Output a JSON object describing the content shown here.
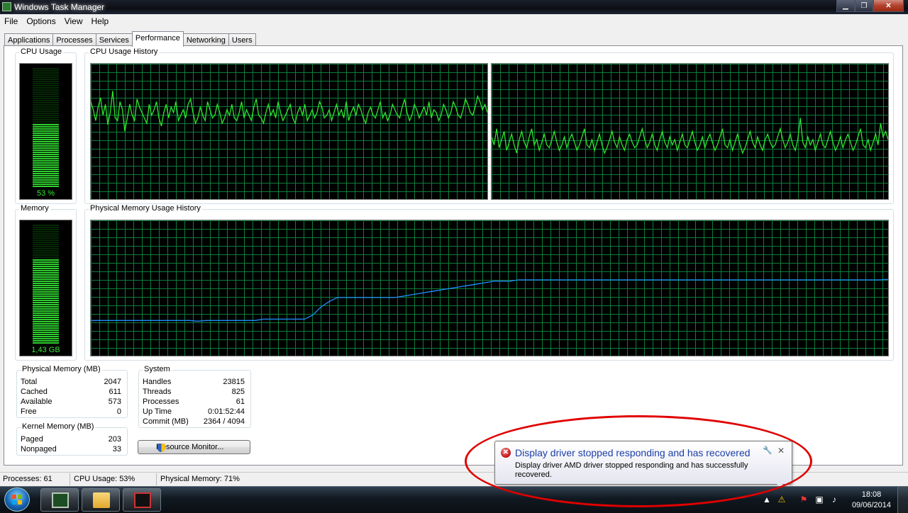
{
  "window": {
    "title": "Windows Task Manager",
    "controls": {
      "minimize": "▁",
      "maximize": "❐",
      "close": "✕"
    }
  },
  "menu": [
    "File",
    "Options",
    "View",
    "Help"
  ],
  "tabs": [
    {
      "label": "Applications",
      "active": false
    },
    {
      "label": "Processes",
      "active": false
    },
    {
      "label": "Services",
      "active": false
    },
    {
      "label": "Performance",
      "active": true
    },
    {
      "label": "Networking",
      "active": false
    },
    {
      "label": "Users",
      "active": false
    }
  ],
  "performance": {
    "cpu_usage": {
      "label": "CPU Usage",
      "value_text": "53 %",
      "level": 0.53
    },
    "cpu_history": {
      "label": "CPU Usage History",
      "core1": [
        72,
        66,
        58,
        68,
        75,
        62,
        70,
        55,
        64,
        80,
        60,
        58,
        72,
        66,
        50,
        60,
        70,
        62,
        58,
        74,
        68,
        64,
        60,
        56,
        70,
        62,
        66,
        72,
        60,
        54,
        64,
        70,
        60,
        68,
        64,
        72,
        58,
        62,
        66,
        60,
        70,
        74,
        64,
        56,
        60,
        68,
        62,
        58,
        72,
        66,
        60,
        62,
        70,
        64,
        56,
        60,
        66,
        62,
        70,
        60,
        58,
        64,
        72,
        60,
        66,
        62,
        58,
        68,
        74,
        62,
        60,
        56,
        64,
        70,
        62,
        66,
        60,
        72,
        64,
        58,
        62,
        66,
        70,
        60,
        56,
        64,
        68,
        62,
        70,
        58,
        62,
        66,
        60,
        64,
        72,
        68,
        60,
        62,
        66,
        58,
        64,
        70,
        62,
        66,
        60,
        72,
        58,
        64,
        68,
        62,
        70,
        66,
        60,
        56,
        64,
        68,
        62,
        60,
        66,
        72,
        60,
        64,
        58,
        62,
        70,
        66,
        62,
        60,
        68,
        74,
        64,
        58,
        62,
        70,
        66,
        60,
        64,
        68,
        62,
        72,
        60,
        66,
        64,
        58,
        62,
        70,
        66,
        60,
        64,
        72,
        68,
        62,
        60,
        66,
        74,
        70,
        64,
        62,
        68,
        76,
        72,
        66,
        70,
        64
      ],
      "core2": [
        46,
        40,
        52,
        38,
        44,
        50,
        36,
        42,
        48,
        40,
        34,
        44,
        50,
        42,
        38,
        46,
        52,
        40,
        44,
        36,
        42,
        48,
        40,
        38,
        44,
        50,
        42,
        36,
        40,
        46,
        38,
        44,
        48,
        42,
        36,
        40,
        46,
        52,
        40,
        38,
        44,
        36,
        42,
        48,
        40,
        34,
        38,
        44,
        50,
        42,
        38,
        46,
        40,
        36,
        44,
        48,
        42,
        38,
        40,
        46,
        52,
        44,
        38,
        42,
        48,
        40,
        36,
        44,
        50,
        42,
        38,
        46,
        40,
        44,
        36,
        42,
        48,
        40,
        38,
        44,
        50,
        42,
        36,
        40,
        46,
        38,
        44,
        48,
        42,
        36,
        40,
        46,
        52,
        40,
        38,
        44,
        36,
        42,
        48,
        40,
        34,
        38,
        44,
        50,
        42,
        38,
        46,
        40,
        36,
        44,
        48,
        42,
        38,
        40,
        46,
        52,
        44,
        38,
        42,
        48,
        40,
        36,
        44,
        60,
        42,
        38,
        46,
        40,
        44,
        36,
        42,
        48,
        40,
        38,
        44,
        50,
        42,
        36,
        40,
        46,
        38,
        44,
        48,
        42,
        36,
        40,
        46,
        52,
        40,
        38,
        44,
        36,
        42,
        48,
        40,
        56,
        46,
        50,
        44
      ]
    },
    "memory": {
      "label": "Memory",
      "value_text": "1,43 GB",
      "level": 0.71
    },
    "memory_history": {
      "label": "Physical Memory Usage History",
      "series": [
        26,
        26,
        26,
        26,
        26,
        26,
        26,
        26,
        26,
        26,
        26,
        26,
        26,
        25.5,
        26,
        26,
        26,
        26,
        26,
        26,
        26,
        27,
        27,
        27,
        27,
        27,
        27,
        30,
        36,
        40,
        43,
        43,
        43,
        43,
        43,
        43,
        43,
        43,
        44,
        45,
        46,
        47,
        48,
        49,
        50,
        51,
        52,
        53,
        54,
        55,
        55,
        55,
        56,
        56,
        56,
        56,
        56,
        56,
        56,
        56,
        56,
        56,
        56,
        56,
        56,
        56,
        56,
        56,
        56,
        56,
        56,
        56,
        56,
        56,
        56,
        56,
        56,
        56,
        56,
        56,
        56,
        56,
        56,
        56,
        56,
        56,
        56,
        56,
        56,
        56,
        56,
        56,
        56,
        56,
        56,
        56,
        56,
        56.5
      ]
    },
    "physical_memory": {
      "label": "Physical Memory (MB)",
      "rows": [
        {
          "key": "Total",
          "value": "2047"
        },
        {
          "key": "Cached",
          "value": "611"
        },
        {
          "key": "Available",
          "value": "573"
        },
        {
          "key": "Free",
          "value": "0"
        }
      ]
    },
    "kernel_memory": {
      "label": "Kernel Memory (MB)",
      "rows": [
        {
          "key": "Paged",
          "value": "203"
        },
        {
          "key": "Nonpaged",
          "value": "33"
        }
      ]
    },
    "system": {
      "label": "System",
      "rows": [
        {
          "key": "Handles",
          "value": "23815"
        },
        {
          "key": "Threads",
          "value": "825"
        },
        {
          "key": "Processes",
          "value": "61"
        },
        {
          "key": "Up Time",
          "value": "0:01:52:44"
        },
        {
          "key": "Commit (MB)",
          "value": "2364 / 4094"
        }
      ]
    },
    "resource_monitor_button": "Resource Monitor..."
  },
  "statusbar": {
    "processes": "Processes: 61",
    "cpu": "CPU Usage: 53%",
    "memory": "Physical Memory: 71%"
  },
  "notification": {
    "title": "Display driver stopped responding and has recovered",
    "body": "Display driver AMD driver stopped responding and has successfully recovered.",
    "close": "✕",
    "options": "🔧"
  },
  "taskbar": {
    "clock_time": "18:08",
    "clock_date": "09/06/2014"
  },
  "colors": {
    "graph_line_cpu": "#2ee62e",
    "graph_line_mem": "#1e90ff",
    "grid": "#0e7c3c",
    "annotation": "#e00000"
  }
}
